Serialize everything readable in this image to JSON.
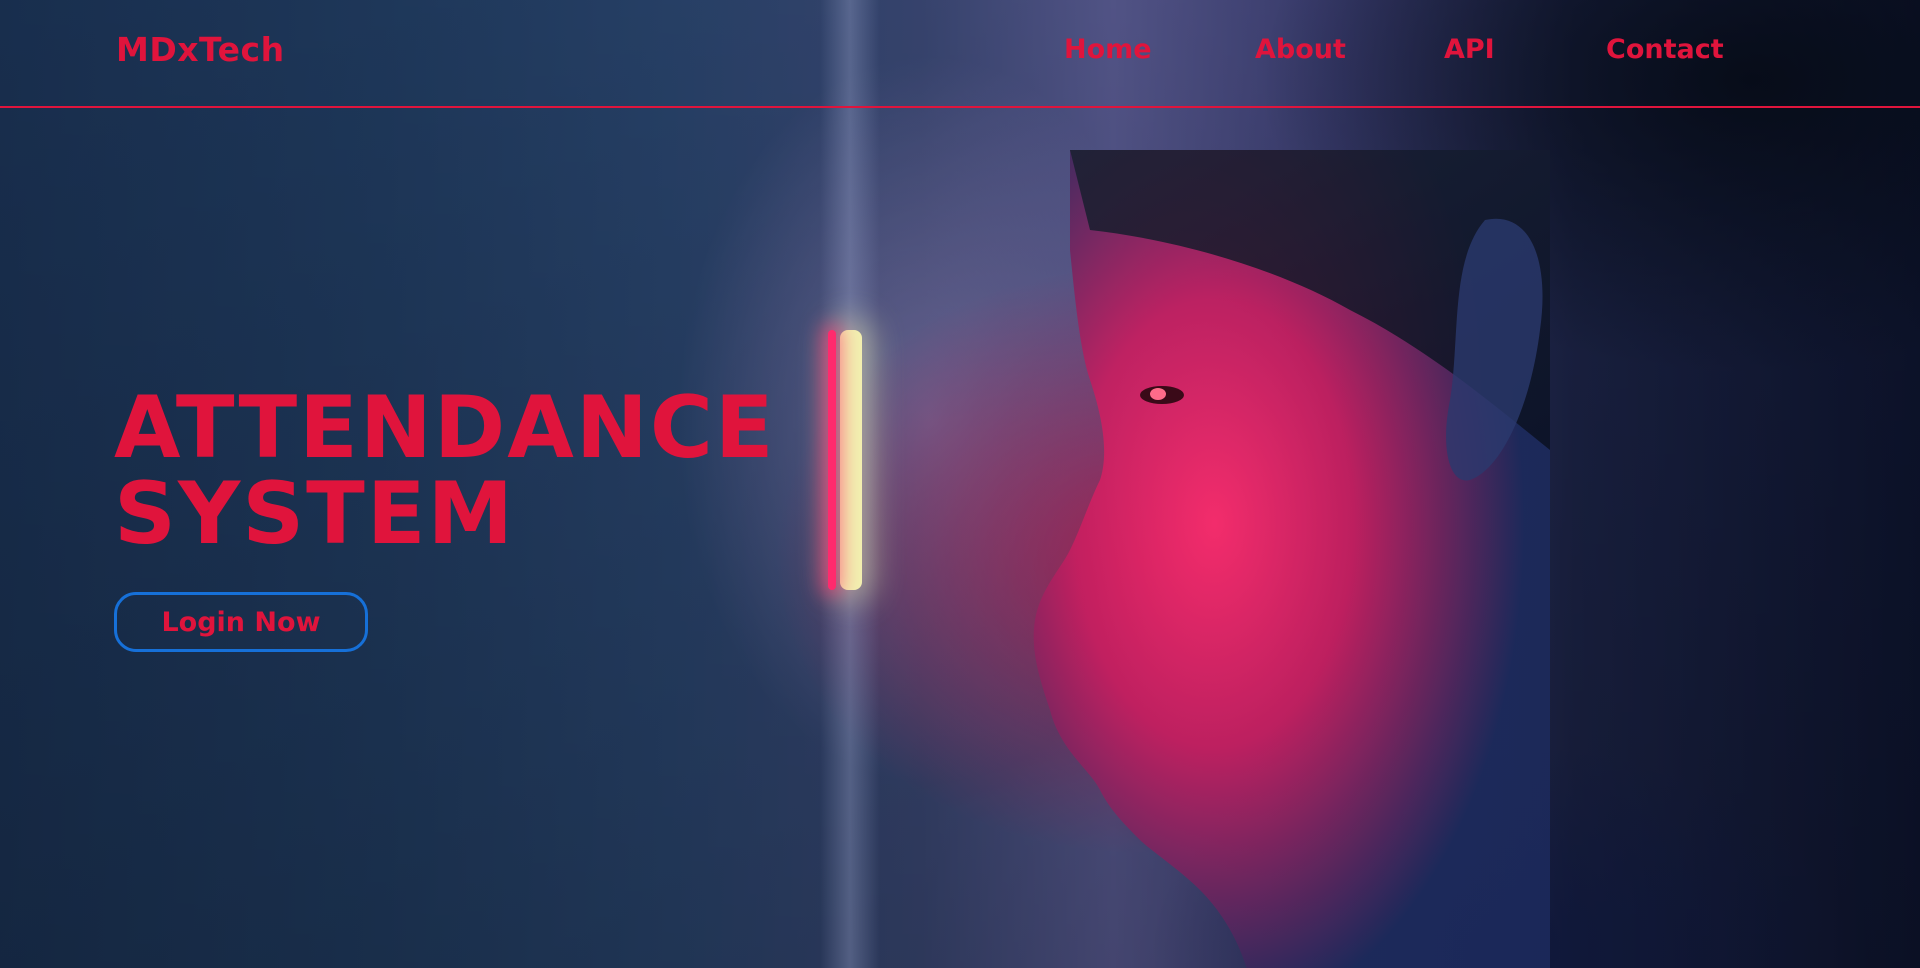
{
  "header": {
    "brand": "MDxTech",
    "nav": {
      "home": "Home",
      "about": "About",
      "api": "API",
      "contact": "Contact"
    }
  },
  "hero": {
    "title_line1": "ATTENDANCE",
    "title_line2": "SYSTEM",
    "login_label": "Login Now"
  },
  "colors": {
    "accent": "#e0143c",
    "button_border": "#1670d8"
  }
}
